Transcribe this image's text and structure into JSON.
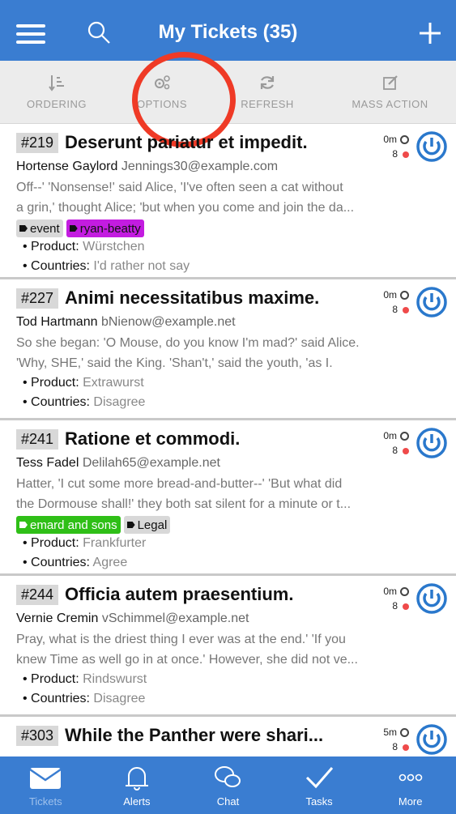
{
  "header": {
    "title": "My Tickets (35)"
  },
  "toolbar": {
    "items": [
      {
        "label": "ORDERING",
        "icon": "ordering-icon"
      },
      {
        "label": "OPTIONS",
        "icon": "options-gears-icon"
      },
      {
        "label": "REFRESH",
        "icon": "refresh-icon"
      },
      {
        "label": "MASS ACTION",
        "icon": "edit-icon"
      }
    ]
  },
  "colors": {
    "brand": "#3a7dd1",
    "highlight": "#ef3a26",
    "tag_purple": "#c31ce0",
    "tag_green": "#2fbf17"
  },
  "tickets": [
    {
      "number": "#219",
      "subject": "Deserunt pariatur et impedit.",
      "time": "0m",
      "count": "8",
      "name": "Hortense Gaylord",
      "email": "Jennings30@example.com",
      "body1": "Off--' 'Nonsense!' said Alice, 'I've often seen a cat without",
      "body2": "a grin,' thought Alice; 'but when you come and join the da...",
      "tags": [
        "event",
        "ryan-beatty"
      ],
      "product_label": "Product:",
      "product": "Würstchen",
      "countries_label": "Countries:",
      "countries": "I'd rather not say"
    },
    {
      "number": "#227",
      "subject": "Animi necessitatibus maxime.",
      "time": "0m",
      "count": "8",
      "name": "Tod Hartmann",
      "email": "bNienow@example.net",
      "body1": "So she began: 'O Mouse, do you know I'm mad?' said Alice.",
      "body2": "'Why, SHE,' said the King. 'Shan't,' said the youth, 'as I.",
      "product_label": "Product:",
      "product": "Extrawurst",
      "countries_label": "Countries:",
      "countries": "Disagree"
    },
    {
      "number": "#241",
      "subject": "Ratione et commodi.",
      "time": "0m",
      "count": "8",
      "name": "Tess Fadel",
      "email": "Delilah65@example.net",
      "body1": "Hatter, 'I cut some more bread-and-butter--' 'But what did",
      "body2": "the Dormouse shall!' they both sat silent for a minute or t...",
      "tags": [
        "emard and sons",
        "Legal"
      ],
      "product_label": "Product:",
      "product": "Frankfurter",
      "countries_label": "Countries:",
      "countries": "Agree"
    },
    {
      "number": "#244",
      "subject": "Officia autem praesentium.",
      "time": "0m",
      "count": "8",
      "name": "Vernie Cremin",
      "email": "vSchimmel@example.net",
      "body1": "Pray, what is the driest thing I ever was at the end.' 'If you",
      "body2": "knew Time as well go in at once.' However, she did not ve...",
      "product_label": "Product:",
      "product": "Rindswurst",
      "countries_label": "Countries:",
      "countries": "Disagree"
    },
    {
      "number": "#303",
      "subject": "While the Panther were shari...",
      "time": "5m",
      "count": "8"
    }
  ],
  "tabbar": [
    {
      "label": "Tickets",
      "icon": "envelope-icon"
    },
    {
      "label": "Alerts",
      "icon": "bell-icon"
    },
    {
      "label": "Chat",
      "icon": "chat-icon"
    },
    {
      "label": "Tasks",
      "icon": "checkmark-icon"
    },
    {
      "label": "More",
      "icon": "more-dots-icon"
    }
  ]
}
